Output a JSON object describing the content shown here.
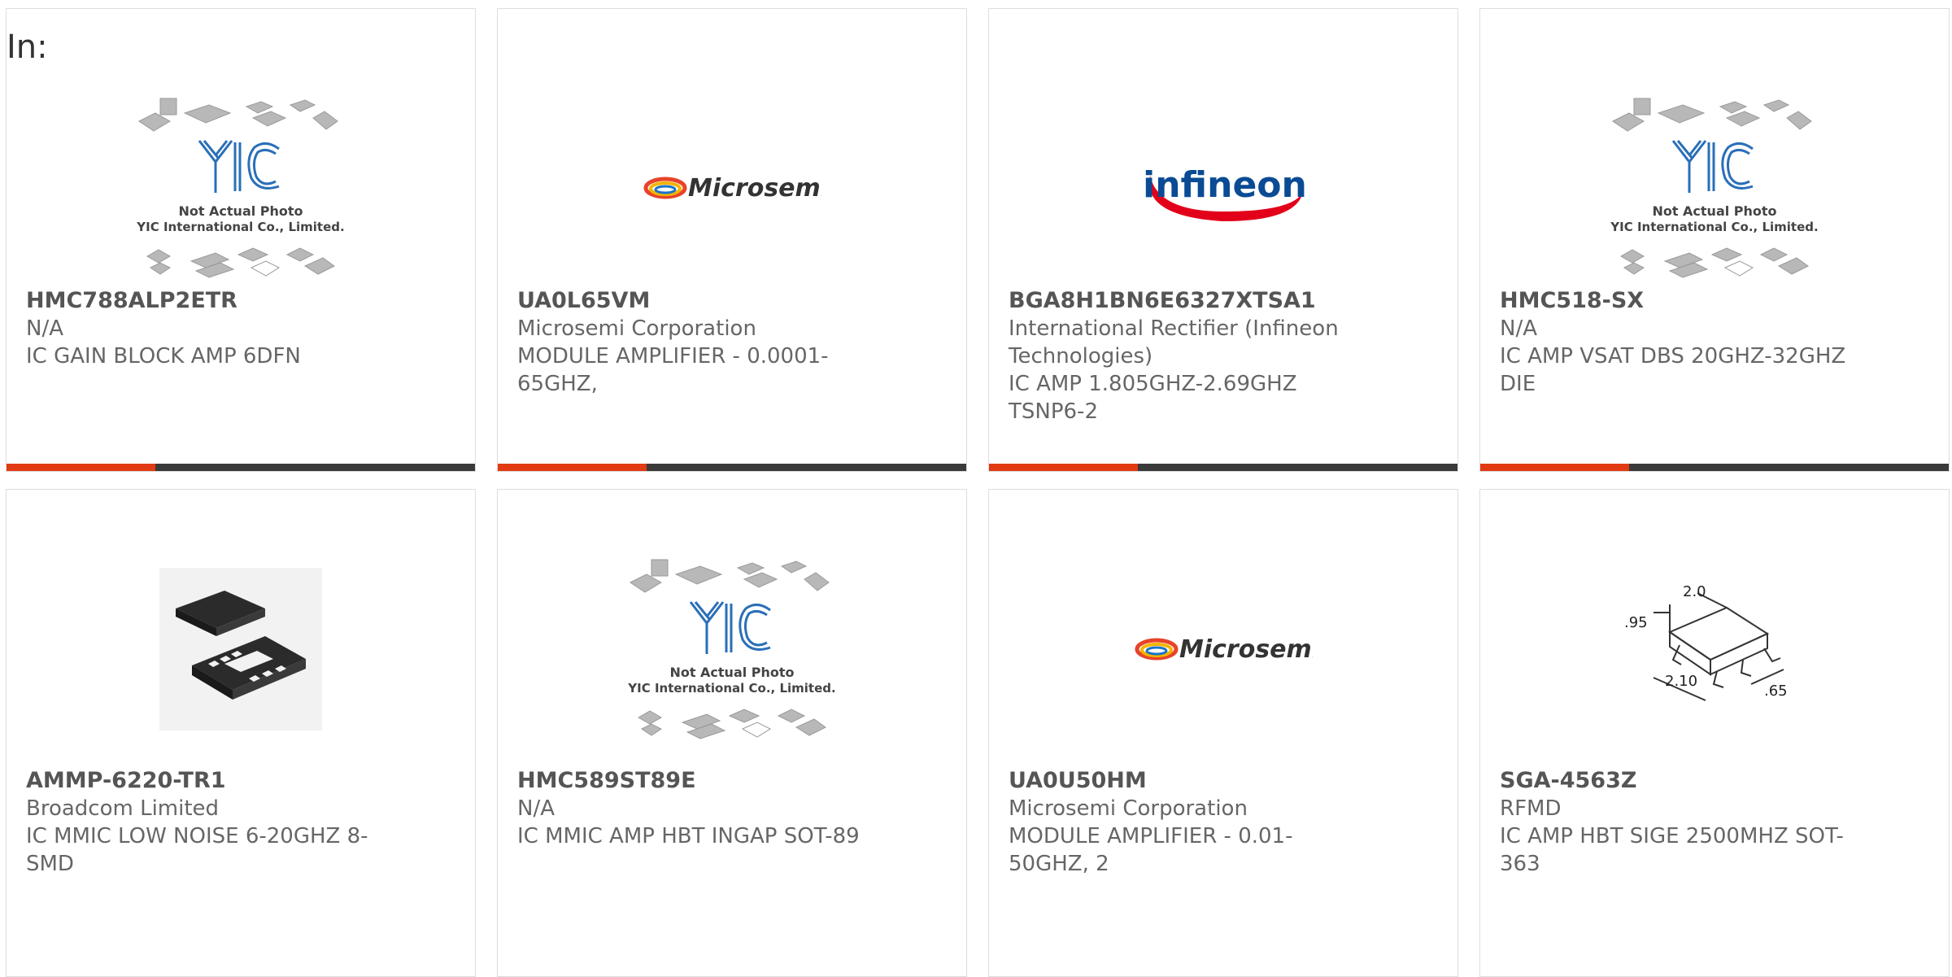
{
  "header": {
    "in_label": "In:"
  },
  "colors": {
    "accent": "#e23a12",
    "bar": "#3a3a3a",
    "title": "#555555",
    "text": "#666666"
  },
  "products": [
    {
      "part": "HMC788ALP2ETR",
      "manufacturer": "N/A",
      "description": "IC GAIN BLOCK AMP 6DFN",
      "image": "not-actual-photo"
    },
    {
      "part": "UA0L65VM",
      "manufacturer": "Microsemi Corporation",
      "description": "MODULE AMPLIFIER - 0.0001-65GHZ,",
      "image": "microsemi-logo"
    },
    {
      "part": "BGA8H1BN6E6327XTSA1",
      "manufacturer": "International Rectifier (Infineon Technologies)",
      "description": "IC AMP 1.805GHZ-2.69GHZ TSNP6-2",
      "image": "infineon-logo"
    },
    {
      "part": "HMC518-SX",
      "manufacturer": "N/A",
      "description": "IC AMP VSAT DBS 20GHZ-32GHZ DIE",
      "image": "not-actual-photo"
    },
    {
      "part": "AMMP-6220-TR1",
      "manufacturer": "Broadcom Limited",
      "description": "IC MMIC LOW NOISE 6-20GHZ 8-SMD",
      "image": "chip-photo"
    },
    {
      "part": "HMC589ST89E",
      "manufacturer": "N/A",
      "description": "IC MMIC AMP HBT INGAP SOT-89",
      "image": "not-actual-photo"
    },
    {
      "part": "UA0U50HM",
      "manufacturer": "Microsemi Corporation",
      "description": "MODULE AMPLIFIER - 0.01-50GHZ, 2",
      "image": "microsemi-logo"
    },
    {
      "part": "SGA-4563Z",
      "manufacturer": "RFMD",
      "description": "IC AMP HBT SIGE 2500MHZ SOT-363",
      "image": "package-drawing"
    }
  ],
  "placeholder": {
    "line1": "Not Actual Photo",
    "line2": "YIC International Co., Limited.",
    "brand": "YIC"
  },
  "logos": {
    "microsemi": "Microsemi",
    "infineon": "infineon"
  },
  "drawing": {
    "dim_top": "2.0",
    "dim_left": ".95",
    "dim_bottom": "2.10",
    "dim_right": ".65"
  }
}
